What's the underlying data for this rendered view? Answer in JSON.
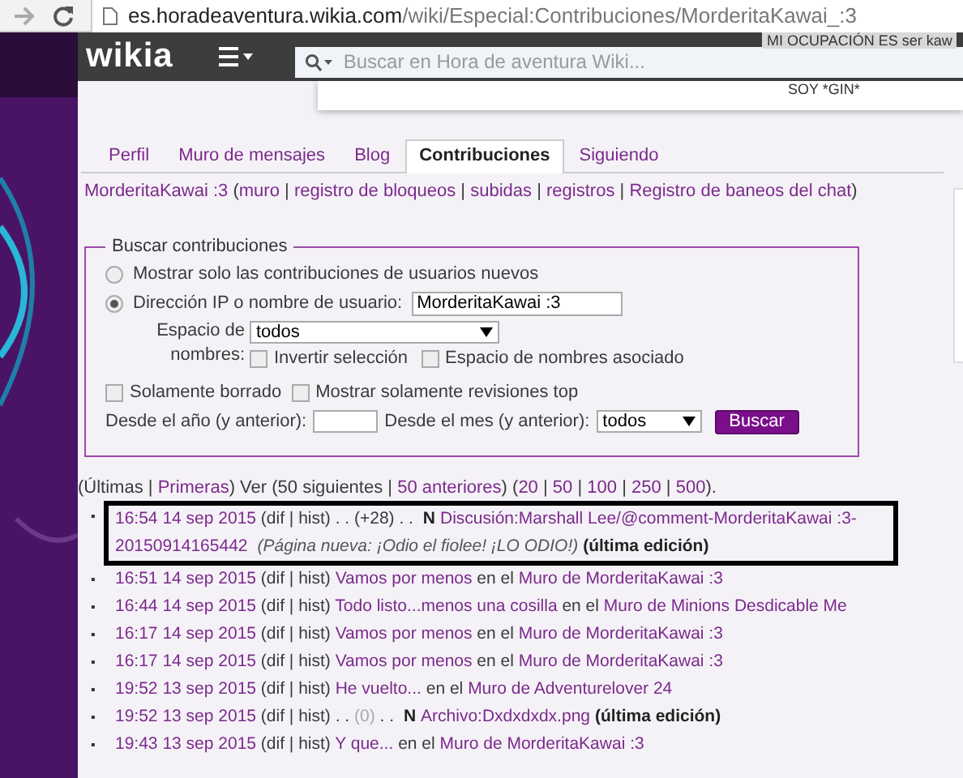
{
  "browser": {
    "url_host": "es.horadeaventura.wikia.com",
    "url_path": "/wiki/Especial:Contribuciones/MorderitaKawai_:3"
  },
  "header": {
    "logo": "wikia",
    "search": {
      "placeholder": "Buscar en Hora de aventura Wiki..."
    }
  },
  "dropdown": {
    "lines": [
      "MI OCUPACIÓN ES ser kaw",
      "SOY *GIN*"
    ]
  },
  "tabs": [
    {
      "label": "Perfil",
      "selected": false
    },
    {
      "label": "Muro de mensajes",
      "selected": false
    },
    {
      "label": "Blog",
      "selected": false
    },
    {
      "label": "Contribuciones",
      "selected": true
    },
    {
      "label": "Siguiendo",
      "selected": false
    }
  ],
  "user_links": [
    {
      "kind": "link",
      "text": "MorderitaKawai :3"
    },
    {
      "kind": "text",
      "text": " ("
    },
    {
      "kind": "link",
      "text": "muro"
    },
    {
      "kind": "text",
      "text": " | "
    },
    {
      "kind": "link",
      "text": "registro de bloqueos"
    },
    {
      "kind": "text",
      "text": " | "
    },
    {
      "kind": "link",
      "text": "subidas"
    },
    {
      "kind": "text",
      "text": " | "
    },
    {
      "kind": "link",
      "text": "registros"
    },
    {
      "kind": "text",
      "text": " | "
    },
    {
      "kind": "link",
      "text": "Registro de baneos del chat"
    },
    {
      "kind": "text",
      "text": ")"
    }
  ],
  "form": {
    "legend": "Buscar contribuciones",
    "radios": [
      {
        "label": "Mostrar solo las contribuciones de usuarios nuevos",
        "selected": false
      },
      {
        "label": "Dirección IP o nombre de usuario:",
        "selected": true
      }
    ],
    "username": "MorderitaKawai :3",
    "namespace_label": "Espacio de nombres:",
    "namespace_value": "todos",
    "namespace_checks": [
      {
        "label": "Invertir selección",
        "checked": false
      },
      {
        "label": "Espacio de nombres asociado",
        "checked": false
      }
    ],
    "checks": [
      {
        "label": "Solamente borrado",
        "checked": false
      },
      {
        "label": "Mostrar solamente revisiones top",
        "checked": false
      }
    ],
    "year_label": "Desde el año (y anterior):",
    "month_label": "Desde el mes (y anterior):",
    "month_value": "todos",
    "button": "Buscar"
  },
  "nav": [
    {
      "kind": "text",
      "text": "(Últimas | "
    },
    {
      "kind": "link",
      "text": "Primeras"
    },
    {
      "kind": "text",
      "text": ") Ver (50 siguientes | "
    },
    {
      "kind": "link",
      "text": "50 anteriores"
    },
    {
      "kind": "text",
      "text": ") ("
    },
    {
      "kind": "link",
      "text": "20"
    },
    {
      "kind": "text",
      "text": " | "
    },
    {
      "kind": "link",
      "text": "50"
    },
    {
      "kind": "text",
      "text": " | "
    },
    {
      "kind": "link",
      "text": "100"
    },
    {
      "kind": "text",
      "text": " | "
    },
    {
      "kind": "link",
      "text": "250"
    },
    {
      "kind": "text",
      "text": " | "
    },
    {
      "kind": "link",
      "text": "500"
    },
    {
      "kind": "text",
      "text": ")."
    }
  ],
  "contributions": [
    {
      "bullet": "▪",
      "highlighted": true,
      "segments": [
        {
          "kind": "link",
          "text": "16:54 14 sep 2015"
        },
        {
          "kind": "text",
          "text": " (dif | hist) . . (+28) . . "
        },
        {
          "kind": "bold",
          "text": "N"
        },
        {
          "kind": "link",
          "text": "Discusión:Marshall Lee/@comment-MorderitaKawai :3-"
        },
        {
          "kind": "link",
          "text": "20150914165442"
        },
        {
          "kind": "italic",
          "text": "(Página nueva: ¡Odio el fiolee! ¡LO ODIO!)"
        },
        {
          "kind": "bold",
          "text": "(última edición)"
        }
      ]
    },
    {
      "bullet": "▪",
      "highlighted": false,
      "segments": [
        {
          "kind": "link",
          "text": "16:51 14 sep 2015"
        },
        {
          "kind": "text",
          "text": " (dif | hist) "
        },
        {
          "kind": "link",
          "text": "Vamos por menos"
        },
        {
          "kind": "text",
          "text": " en el "
        },
        {
          "kind": "link",
          "text": "Muro de MorderitaKawai :3"
        }
      ]
    },
    {
      "bullet": "▪",
      "highlighted": false,
      "segments": [
        {
          "kind": "link",
          "text": "16:44 14 sep 2015"
        },
        {
          "kind": "text",
          "text": " (dif | hist) "
        },
        {
          "kind": "link",
          "text": "Todo listo...menos una cosilla"
        },
        {
          "kind": "text",
          "text": " en el "
        },
        {
          "kind": "link",
          "text": "Muro de Minions Desdicable Me"
        }
      ]
    },
    {
      "bullet": "▪",
      "highlighted": false,
      "segments": [
        {
          "kind": "link",
          "text": "16:17 14 sep 2015"
        },
        {
          "kind": "text",
          "text": " (dif | hist) "
        },
        {
          "kind": "link",
          "text": "Vamos por menos"
        },
        {
          "kind": "text",
          "text": " en el "
        },
        {
          "kind": "link",
          "text": "Muro de MorderitaKawai :3"
        }
      ]
    },
    {
      "bullet": "▪",
      "highlighted": false,
      "segments": [
        {
          "kind": "link",
          "text": "16:17 14 sep 2015"
        },
        {
          "kind": "text",
          "text": " (dif | hist) "
        },
        {
          "kind": "link",
          "text": "Vamos por menos"
        },
        {
          "kind": "text",
          "text": " en el "
        },
        {
          "kind": "link",
          "text": "Muro de MorderitaKawai :3"
        }
      ]
    },
    {
      "bullet": "▪",
      "highlighted": false,
      "segments": [
        {
          "kind": "link",
          "text": "19:52 13 sep 2015"
        },
        {
          "kind": "text",
          "text": " (dif | hist) "
        },
        {
          "kind": "link",
          "text": "He vuelto..."
        },
        {
          "kind": "text",
          "text": " en el "
        },
        {
          "kind": "link",
          "text": "Muro de Adventurelover 24"
        }
      ]
    },
    {
      "bullet": "▪",
      "highlighted": false,
      "segments": [
        {
          "kind": "link",
          "text": "19:52 13 sep 2015"
        },
        {
          "kind": "text",
          "text": " (dif | hist) . . "
        },
        {
          "kind": "muted",
          "text": "(0)"
        },
        {
          "kind": "text",
          "text": " . . "
        },
        {
          "kind": "bold",
          "text": "N"
        },
        {
          "kind": "link",
          "text": "Archivo:Dxdxdxdx.png"
        },
        {
          "kind": "bold",
          "text": "(última edición)"
        }
      ]
    },
    {
      "bullet": "▪",
      "highlighted": false,
      "segments": [
        {
          "kind": "link",
          "text": "19:43 13 sep 2015"
        },
        {
          "kind": "text",
          "text": " (dif | hist) "
        },
        {
          "kind": "link",
          "text": "Y que..."
        },
        {
          "kind": "text",
          "text": " en el "
        },
        {
          "kind": "link",
          "text": "Muro de MorderitaKawai :3"
        }
      ]
    }
  ]
}
